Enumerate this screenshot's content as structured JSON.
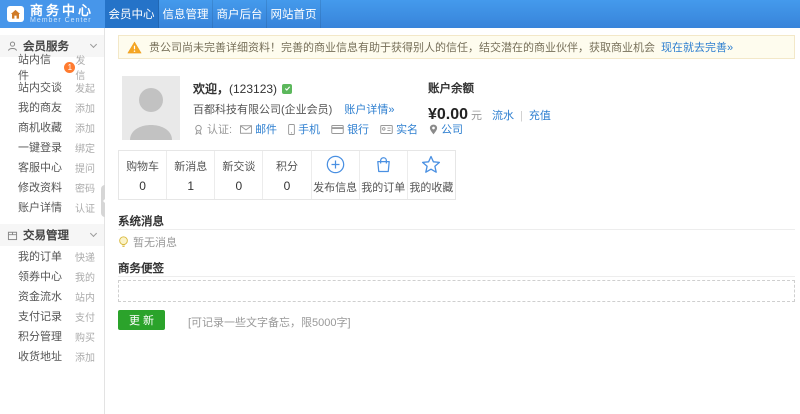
{
  "header": {
    "logo": {
      "title": "商务中心",
      "subtitle": "Member Center"
    },
    "tabs": [
      {
        "label": "会员中心",
        "active": true
      },
      {
        "label": "信息管理",
        "active": false
      },
      {
        "label": "商户后台",
        "active": false
      },
      {
        "label": "网站首页",
        "active": false
      }
    ]
  },
  "sidebar": {
    "groups": [
      {
        "title": "会员服务",
        "icon": "user-icon",
        "items": [
          {
            "label": "站内信件",
            "badge": "1",
            "action": "发信"
          },
          {
            "label": "站内交谈",
            "action": "发起"
          },
          {
            "label": "我的商友",
            "action": "添加"
          },
          {
            "label": "商机收藏",
            "action": "添加"
          },
          {
            "label": "一键登录",
            "action": "绑定"
          },
          {
            "label": "客服中心",
            "action": "提问"
          },
          {
            "label": "修改资料",
            "action": "密码"
          },
          {
            "label": "账户详情",
            "action": "认证"
          }
        ]
      },
      {
        "title": "交易管理",
        "icon": "box-icon",
        "items": [
          {
            "label": "我的订单",
            "action": "快递"
          },
          {
            "label": "领券中心",
            "action": "我的"
          },
          {
            "label": "资金流水",
            "action": "站内"
          },
          {
            "label": "支付记录",
            "action": "支付"
          },
          {
            "label": "积分管理",
            "action": "购买"
          },
          {
            "label": "收货地址",
            "action": "添加"
          }
        ]
      }
    ]
  },
  "banner": {
    "text": "贵公司尚未完善详细资料！完善的商业信息有助于获得别人的信任，结交潜在的商业伙伴，获取商业机会",
    "link": "现在就去完善»"
  },
  "profile": {
    "welcome_prefix": "欢迎，",
    "account_id": "(123123)",
    "company": "百都科技有限公司(企业会员)",
    "details_link": "账户详情»",
    "cert_label": "认证:",
    "cert_items": [
      "邮件",
      "手机",
      "银行",
      "实名",
      "公司"
    ]
  },
  "balance": {
    "title": "账户余额",
    "amount": "¥0.00",
    "unit": "元",
    "links": [
      "流水",
      "充值"
    ],
    "separator": "|"
  },
  "stats": {
    "counters": [
      {
        "label": "购物车",
        "value": "0"
      },
      {
        "label": "新消息",
        "value": "1"
      },
      {
        "label": "新交谈",
        "value": "0"
      },
      {
        "label": "积分",
        "value": "0"
      }
    ],
    "actions": [
      {
        "label": "发布信息",
        "icon": "circle-plus-icon"
      },
      {
        "label": "我的订单",
        "icon": "bag-icon"
      },
      {
        "label": "我的收藏",
        "icon": "star-icon"
      }
    ]
  },
  "system_messages": {
    "title": "系统消息",
    "empty_text": "暂无消息"
  },
  "notes": {
    "title": "商务便签",
    "value": "",
    "update_button": "更 新",
    "hint": "[可记录一些文字备忘，限5000字]"
  },
  "colors": {
    "header_blue": "#3D8DE2",
    "active_tab_blue": "#2573C8",
    "link_blue": "#2E7FD0",
    "button_green": "#2BA32B",
    "badge_orange": "#FF7B2F",
    "warning_orange": "#F5A623",
    "icon_blue": "#4A90E2"
  }
}
